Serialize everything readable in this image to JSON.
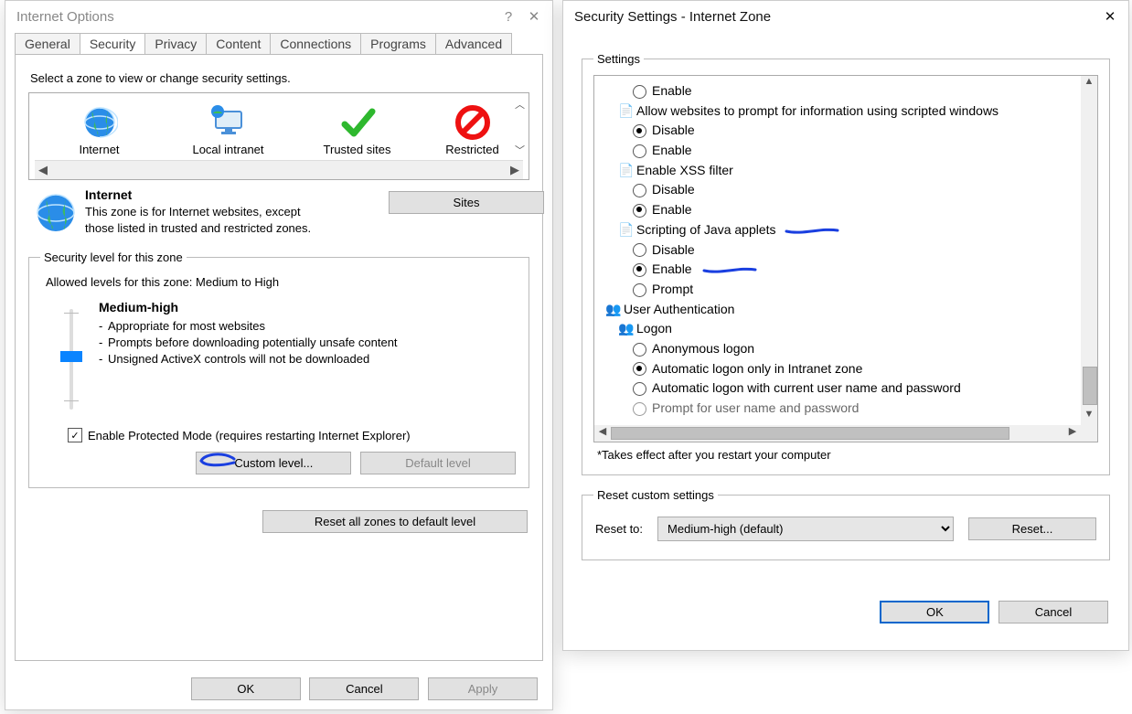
{
  "left": {
    "title": "Internet Options",
    "tabs": [
      "General",
      "Security",
      "Privacy",
      "Content",
      "Connections",
      "Programs",
      "Advanced"
    ],
    "active_tab": "Security",
    "zone_heading": "Select a zone to view or change security settings.",
    "zones": [
      "Internet",
      "Local intranet",
      "Trusted sites",
      "Restricted"
    ],
    "selected_zone": {
      "name": "Internet",
      "desc": "This zone is for Internet websites, except those listed in trusted and restricted zones."
    },
    "sites_btn": "Sites",
    "sec_group_title": "Security level for this zone",
    "allowed_levels": "Allowed levels for this zone: Medium to High",
    "level_name": "Medium-high",
    "level_bullets": [
      "Appropriate for most websites",
      "Prompts before downloading potentially unsafe content",
      "Unsigned ActiveX controls will not be downloaded"
    ],
    "protected_mode": "Enable Protected Mode (requires restarting Internet Explorer)",
    "custom_level_btn": "Custom level...",
    "default_level_btn": "Default level",
    "reset_all_btn": "Reset all zones to default level",
    "ok": "OK",
    "cancel": "Cancel",
    "apply": "Apply"
  },
  "right": {
    "title": "Security Settings - Internet Zone",
    "settings_label": "Settings",
    "tree": {
      "n0": "Enable",
      "g1": "Allow websites to prompt for information using scripted windows",
      "g1a": "Disable",
      "g1b": "Enable",
      "g2": "Enable XSS filter",
      "g2a": "Disable",
      "g2b": "Enable",
      "g3": "Scripting of Java applets",
      "g3a": "Disable",
      "g3b": "Enable",
      "g3c": "Prompt",
      "g4": "User Authentication",
      "g4s": "Logon",
      "g4a": "Anonymous logon",
      "g4b": "Automatic logon only in Intranet zone",
      "g4c": "Automatic logon with current user name and password",
      "g4d": "Prompt for user name and password"
    },
    "note": "*Takes effect after you restart your computer",
    "reset_group": "Reset custom settings",
    "reset_to": "Reset to:",
    "reset_value": "Medium-high (default)",
    "reset_btn": "Reset...",
    "ok": "OK",
    "cancel": "Cancel"
  }
}
